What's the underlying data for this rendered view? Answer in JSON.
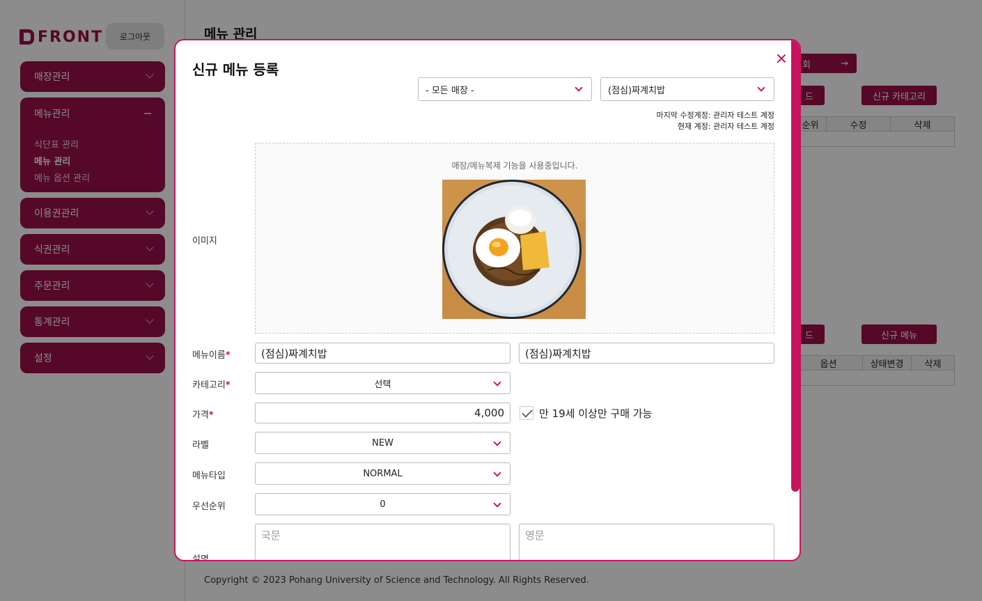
{
  "sidebar": {
    "logo": "FRONT",
    "logout": "로그아웃",
    "menus": [
      {
        "label": "매장관리"
      },
      {
        "label": "메뉴관리",
        "children": [
          "식단표 관리",
          "메뉴 관리",
          "메뉴 옵션 관리"
        ]
      },
      {
        "label": "이용권관리"
      },
      {
        "label": "식권관리"
      },
      {
        "label": "주문관리"
      },
      {
        "label": "통계관리"
      },
      {
        "label": "설정"
      }
    ]
  },
  "background": {
    "title": "메뉴 관리",
    "btn_top": "회",
    "btn_upload1": "드",
    "btn_new_category": "신규 카테고리",
    "table1_headers": [
      "순위",
      "수정",
      "삭제"
    ],
    "btn_upload2": "드",
    "btn_new_menu": "신규 메뉴",
    "table2_headers": [
      "옵션",
      "상태변경",
      "삭제"
    ],
    "footer": "Copyright © 2023 Pohang University of Science and Technology. All Rights Reserved."
  },
  "modal": {
    "title": "신규 메뉴 등록",
    "store_select": "- 모든 매장 -",
    "menu_select": "(점심)짜계치밥",
    "last_modified": "마지막 수정계정: 관리자 테스트 계정",
    "current_account": "현재 계정: 관리자 테스트 계정",
    "image_label": "이미지",
    "image_message": "매장/메뉴복제 기능을 사용중입니다.",
    "name_label": "메뉴이름",
    "name_ko": "(점심)짜계치밥",
    "name_en": "(점심)짜계치밥",
    "category_label": "카테고리",
    "category_value": "선택",
    "price_label": "가격",
    "price_value": "4,000",
    "adult_only_label": "만 19세 이상만 구매 가능",
    "badge_label": "라벨",
    "badge_value": "NEW",
    "type_label": "메뉴타입",
    "type_value": "NORMAL",
    "priority_label": "우선순위",
    "priority_value": "0",
    "desc_label": "설명",
    "desc_ko_placeholder": "국문",
    "desc_en_placeholder": "영문",
    "required_mark": "*"
  },
  "colors": {
    "brand": "#9b0f47",
    "accent": "#c8145f"
  }
}
